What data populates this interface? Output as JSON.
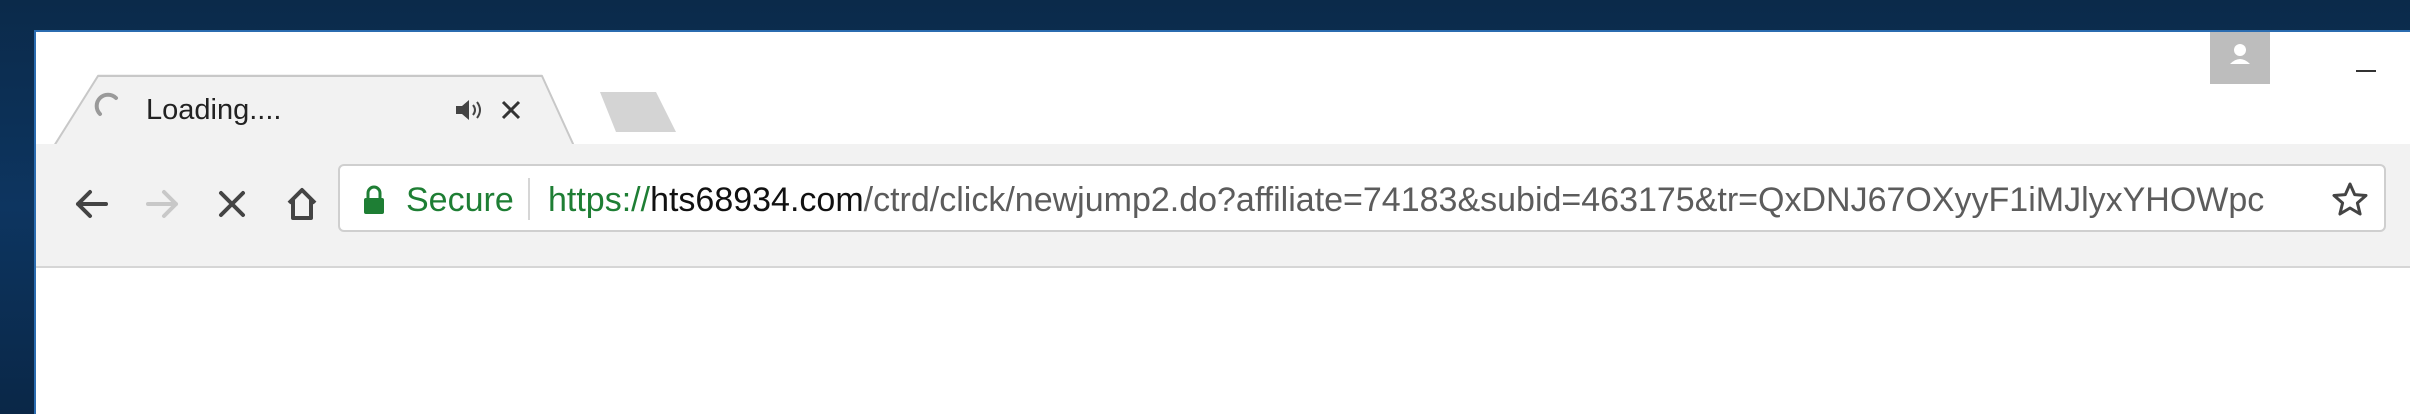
{
  "tab": {
    "title": "Loading....",
    "spinner_icon": "loading-spinner-icon",
    "audio_icon": "speaker-icon",
    "close_icon": "close-icon"
  },
  "window": {
    "profile_icon": "person-icon",
    "minimize_icon": "minimize-icon"
  },
  "toolbar": {
    "back_icon": "arrow-left-icon",
    "forward_icon": "arrow-right-icon",
    "stop_icon": "stop-x-icon",
    "home_icon": "home-icon"
  },
  "omnibox": {
    "security_label": "Secure",
    "url_scheme": "https://",
    "url_host": "hts68934.com",
    "url_path": "/ctrd/click/newjump2.do?affiliate=74183&subid=463175&tr=QxDNJ67OXyyF1iMJlyxYHOWpс",
    "lock_icon": "lock-icon",
    "bookmark_icon": "star-icon"
  },
  "colors": {
    "secure_green": "#1e7e34",
    "toolbar_bg": "#f2f2f2",
    "desktop_bg": "#0d3560"
  }
}
